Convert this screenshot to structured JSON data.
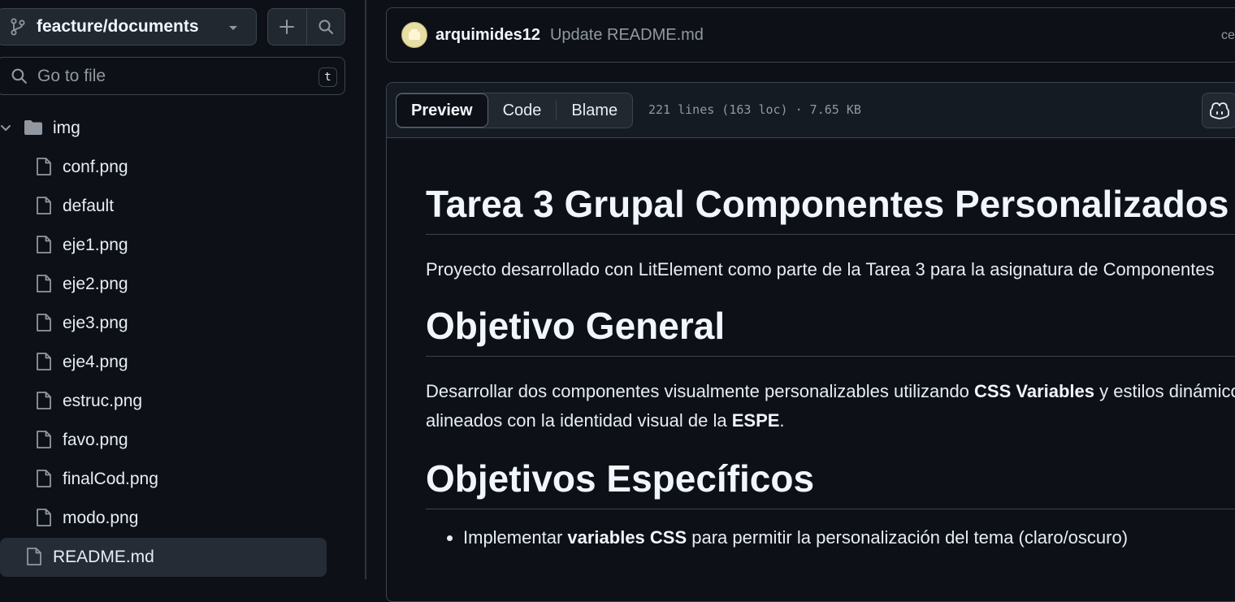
{
  "sidebar": {
    "branch": "feacture/documents",
    "goto_placeholder": "Go to file",
    "goto_shortcut": "t",
    "folder": {
      "name": "img",
      "expanded": true
    },
    "files": [
      "conf.png",
      "default",
      "eje1.png",
      "eje2.png",
      "eje3.png",
      "eje4.png",
      "estruc.png",
      "favo.png",
      "finalCod.png",
      "modo.png"
    ],
    "selected_file": "README.md"
  },
  "commit": {
    "author": "arquimides12",
    "message": "Update README.md",
    "right_text": "ce"
  },
  "file_header": {
    "tabs": [
      "Preview",
      "Code",
      "Blame"
    ],
    "active_tab": "Preview",
    "meta": "221 lines (163 loc) · 7.65 KB"
  },
  "readme": {
    "h1_title": "Tarea 3 Grupal Componentes Personalizados",
    "intro": "Proyecto desarrollado con LitElement como parte de la Tarea 3 para la asignatura de Componentes",
    "h_objetivo_general": "Objetivo General",
    "obj_part1": "Desarrollar dos componentes visualmente personalizables utilizando ",
    "obj_bold1": "CSS Variables",
    "obj_part2": " y estilos dinámicos",
    "obj_part3": "alineados con la identidad visual de la ",
    "obj_bold2": "ESPE",
    "obj_part4": ".",
    "h_objetivos_especificos": "Objetivos Específicos",
    "bullet1_part1": "Implementar ",
    "bullet1_bold": "variables CSS",
    "bullet1_part2": " para permitir la personalización del tema (claro/oscuro)"
  },
  "colors": {
    "background": "#0d1117",
    "border": "#3d444d",
    "text": "#e6edf3",
    "muted": "#9198a1"
  }
}
